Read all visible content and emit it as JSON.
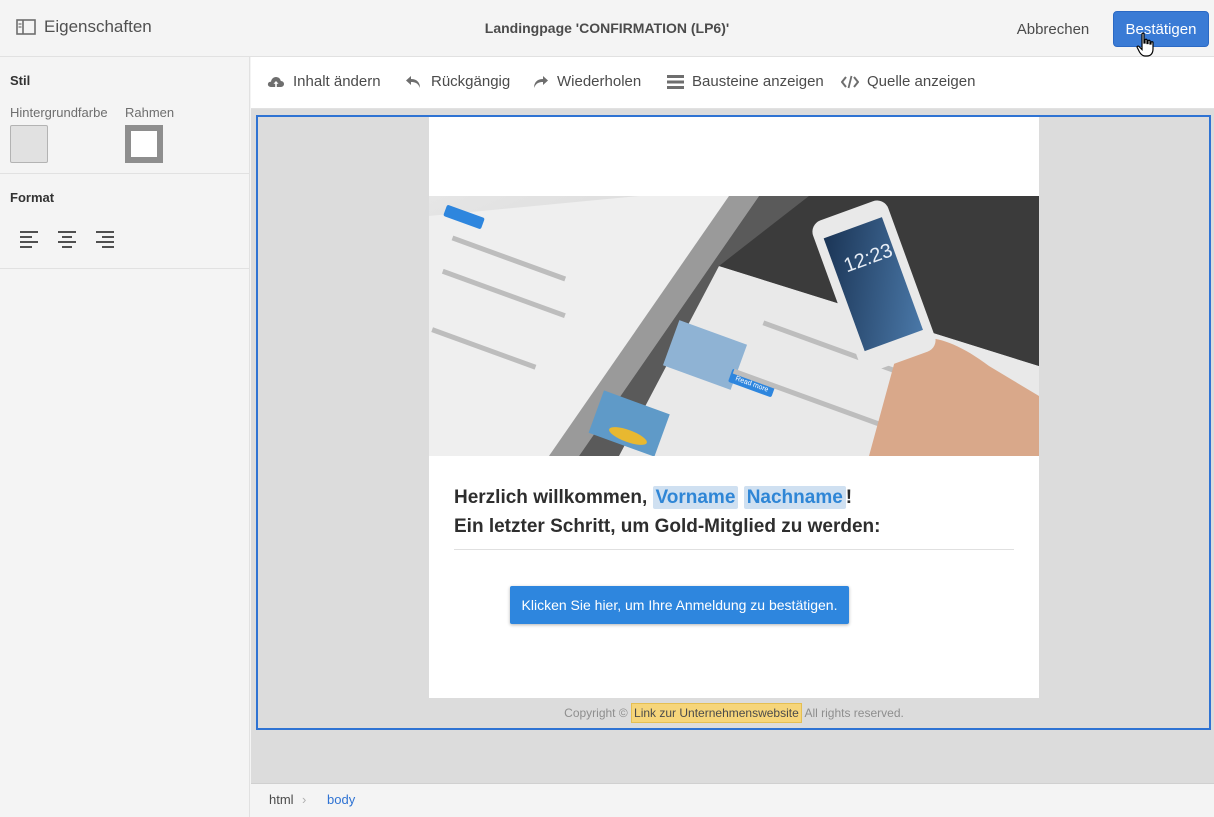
{
  "header": {
    "properties_label": "Eigenschaften",
    "title": "Landingpage 'CONFIRMATION (LP6)'",
    "cancel_label": "Abbrechen",
    "confirm_label": "Bestätigen"
  },
  "sidebar": {
    "style_title": "Stil",
    "background_label": "Hintergrundfarbe",
    "border_label": "Rahmen",
    "format_title": "Format"
  },
  "toolbar": {
    "change_content": "Inhalt ändern",
    "undo": "Rückgängig",
    "redo": "Wiederholen",
    "show_blocks": "Bausteine anzeigen",
    "show_source": "Quelle anzeigen"
  },
  "content": {
    "welcome_prefix": "Herzlich willkommen, ",
    "firstname": "Vorname",
    "lastname": "Nachname",
    "welcome_suffix": "!",
    "subline": "Ein letzter Schritt, um Gold-Mitglied zu werden:",
    "cta_label": "Klicken Sie hier, um Ihre Anmeldung zu bestätigen.",
    "footer_prefix": "Copyright © ",
    "footer_link": "Link zur Unternehmenswebsite",
    "footer_suffix": " All rights reserved.",
    "hero_texts": {
      "read_more": "Read more",
      "clock": "12:23"
    }
  },
  "breadcrumb": [
    "html",
    "body"
  ],
  "colors": {
    "accent": "#3a7bd5",
    "selection": "#2f73d3",
    "personalization": "#2f86d6",
    "link_highlight": "#f6d57a"
  }
}
